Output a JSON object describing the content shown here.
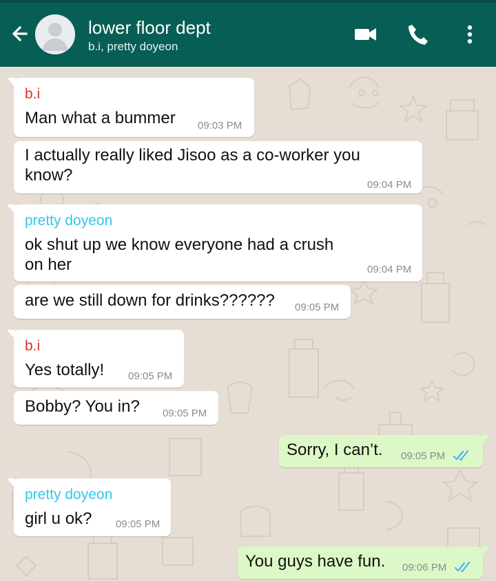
{
  "colors": {
    "header": "#075e54",
    "wallpaper": "#e6ddd4",
    "incoming_bubble": "#ffffff",
    "outgoing_bubble": "#dcf8c6",
    "sender_bi": "#e0302a",
    "sender_doyeon": "#35c6e6",
    "read_tick": "#4fb3f3"
  },
  "header": {
    "title": "lower floor dept",
    "subtitle": "b.i, pretty doyeon",
    "icons": [
      "back-arrow-icon",
      "avatar",
      "video-call-icon",
      "phone-icon",
      "more-options-icon"
    ]
  },
  "messages": [
    {
      "sender": "b.i",
      "text": "Man what a bummer",
      "time": "09:03 PM"
    },
    {
      "text": "I actually really liked Jisoo as a co-worker you know?",
      "time": "09:04 PM"
    },
    {
      "sender": "pretty doyeon",
      "text": "ok shut up we know everyone had a crush on her",
      "time": "09:04 PM"
    },
    {
      "text": "are we still down for drinks??????",
      "time": "09:05 PM"
    },
    {
      "sender": "b.i",
      "text": "Yes totally!",
      "time": "09:05 PM"
    },
    {
      "text": "Bobby? You in?",
      "time": "09:05 PM"
    },
    {
      "text": "Sorry, I can’t.",
      "time": "09:05 PM",
      "status": "read"
    },
    {
      "sender": "pretty doyeon",
      "text": "girl u ok?",
      "time": "09:05 PM"
    },
    {
      "text": "You guys have fun.",
      "time": "09:06 PM",
      "status": "read"
    }
  ]
}
